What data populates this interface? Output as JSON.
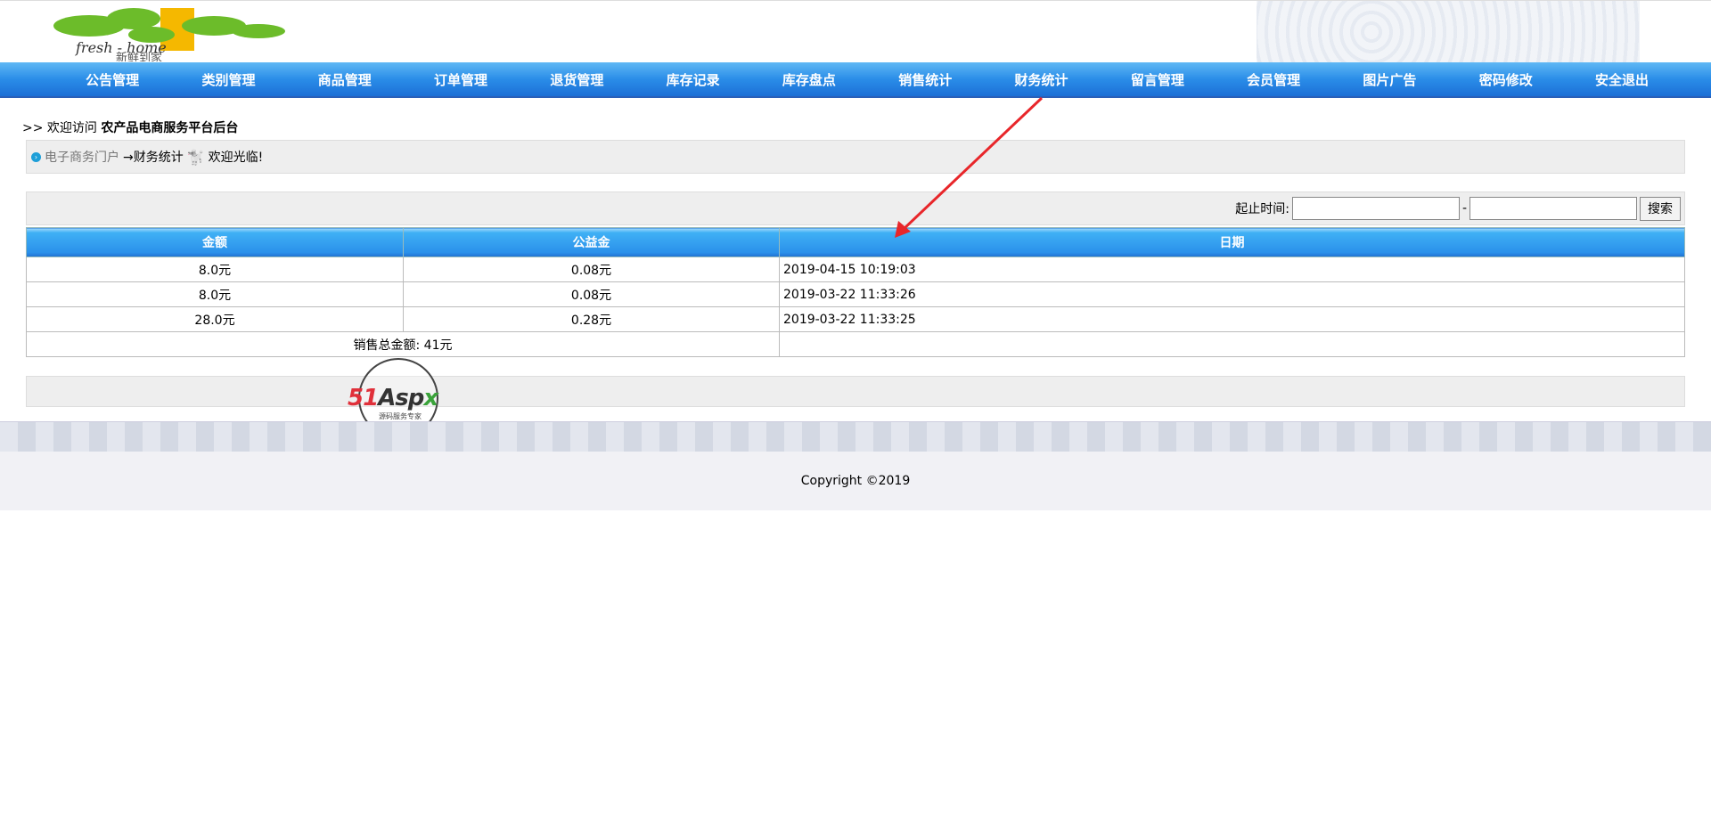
{
  "header": {
    "logo_text_en": "fresh-home",
    "logo_text_cn": "新鲜到家"
  },
  "nav": [
    "公告管理",
    "类别管理",
    "商品管理",
    "订单管理",
    "退货管理",
    "库存记录",
    "库存盘点",
    "销售统计",
    "财务统计",
    "留言管理",
    "会员管理",
    "图片广告",
    "密码修改",
    "安全退出"
  ],
  "welcome": {
    "prefix": ">> 欢迎访问",
    "site": "农产品电商服务平台后台"
  },
  "breadcrumb": {
    "home": "电子商务门户",
    "current": "→财务统计",
    "greeting": "欢迎光临!"
  },
  "search": {
    "label": "起止时间:",
    "separator": "-",
    "start_value": "",
    "end_value": "",
    "button": "搜索"
  },
  "table": {
    "headers": [
      "金额",
      "公益金",
      "日期"
    ],
    "rows": [
      [
        "8.0元",
        "0.08元",
        "2019-04-15 10:19:03"
      ],
      [
        "8.0元",
        "0.08元",
        "2019-03-22 11:33:26"
      ],
      [
        "28.0元",
        "0.28元",
        "2019-03-22 11:33:25"
      ]
    ],
    "total": "销售总金额: 41元"
  },
  "watermark": {
    "brand": "51Aspx",
    "sub": "源码服务专家"
  },
  "footer": {
    "copyright": "Copyright ©2019"
  },
  "colors": {
    "nav": "#2a8de8",
    "arrow": "#e8262a"
  }
}
